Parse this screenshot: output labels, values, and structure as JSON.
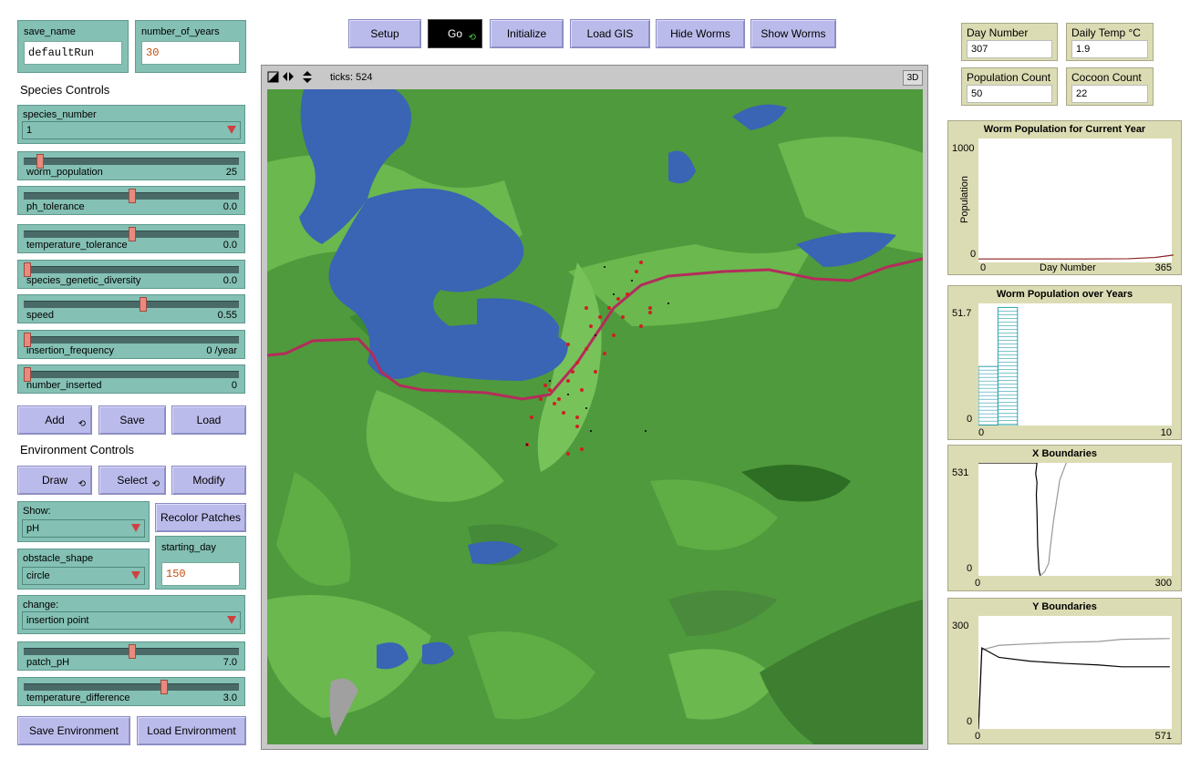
{
  "inputs": {
    "save_name": {
      "label": "save_name",
      "value": "defaultRun"
    },
    "number_of_years": {
      "label": "number_of_years",
      "value": "30"
    },
    "starting_day": {
      "label": "starting_day",
      "value": "150"
    }
  },
  "section_titles": {
    "species": "Species Controls",
    "environment": "Environment Controls"
  },
  "choosers": {
    "species_number": {
      "label": "species_number",
      "value": "1"
    },
    "show": {
      "label": "Show:",
      "value": "pH"
    },
    "obstacle_shape": {
      "label": "obstacle_shape",
      "value": "circle"
    },
    "change": {
      "label": "change:",
      "value": "insertion point"
    }
  },
  "sliders": {
    "worm_population": {
      "name": "worm_population",
      "value": "25",
      "fraction": 0.06
    },
    "ph_tolerance": {
      "name": "ph_tolerance",
      "value": "0.0",
      "fraction": 0.5
    },
    "temperature_tolerance": {
      "name": "temperature_tolerance",
      "value": "0.0",
      "fraction": 0.5
    },
    "species_genetic_diversity": {
      "name": "species_genetic_diversity",
      "value": "0.0",
      "fraction": 0.0
    },
    "speed": {
      "name": "speed",
      "value": "0.55",
      "fraction": 0.55
    },
    "insertion_frequency": {
      "name": "insertion_frequency",
      "value": "0 /year",
      "fraction": 0.0
    },
    "number_inserted": {
      "name": "number_inserted",
      "value": "0",
      "fraction": 0.0
    },
    "patch_pH": {
      "name": "patch_pH",
      "value": "7.0",
      "fraction": 0.5
    },
    "temperature_difference": {
      "name": "temperature_difference",
      "value": "3.0",
      "fraction": 0.65
    }
  },
  "buttons": {
    "add": "Add",
    "save": "Save",
    "load": "Load",
    "draw": "Draw",
    "select": "Select",
    "modify": "Modify",
    "recolor": "Recolor Patches",
    "save_env": "Save Environment",
    "load_env": "Load Environment",
    "setup": "Setup",
    "go": "Go",
    "initialize": "Initialize",
    "load_gis": "Load GIS",
    "hide_worms": "Hide Worms",
    "show_worms": "Show Worms",
    "forever_glyph": "⟲"
  },
  "view": {
    "ticks_label": "ticks: 524",
    "three_d": "3D"
  },
  "monitors": {
    "day_number": {
      "label": "Day Number",
      "value": "307"
    },
    "daily_temp": {
      "label": "Daily Temp °C",
      "value": "1.9"
    },
    "population_count": {
      "label": "Population Count",
      "value": "50"
    },
    "cocoon_count": {
      "label": "Cocoon Count",
      "value": "22"
    }
  },
  "colors": {
    "teal": "#84c0b4",
    "button": "#bbbbeb",
    "monitor": "#dcdcb4",
    "slider_knob": "#e88a7e",
    "water": "#3a64b4",
    "road": "#b42c5c"
  },
  "chart_data": [
    {
      "type": "line",
      "title": "Worm Population for Current Year",
      "xlabel": "Day Number",
      "ylabel": "Population",
      "xlim": [
        0,
        365
      ],
      "ylim": [
        0,
        1000
      ],
      "series": [
        {
          "color": "#8b2020",
          "x": [
            0,
            100,
            200,
            280,
            330,
            365
          ],
          "y": [
            28,
            28,
            28,
            30,
            40,
            60
          ]
        }
      ]
    },
    {
      "type": "bar",
      "title": "Worm Population over Years",
      "xlim": [
        0,
        10
      ],
      "ylim": [
        0,
        51.7
      ],
      "series": [
        {
          "color": "#30a0b0",
          "x": [
            0,
            1
          ],
          "y": [
            25,
            50
          ]
        }
      ]
    },
    {
      "type": "line",
      "title": "X Boundaries",
      "xlim": [
        0,
        300
      ],
      "ylim": [
        0,
        531
      ],
      "series": [
        {
          "color": "#000000",
          "x": [
            0,
            90,
            88,
            90,
            89,
            90,
            91,
            93,
            95
          ],
          "y": [
            531,
            531,
            480,
            440,
            380,
            300,
            150,
            30,
            0
          ]
        },
        {
          "color": "#999999",
          "x": [
            95,
            102,
            108,
            110,
            115,
            120,
            125,
            135
          ],
          "y": [
            0,
            20,
            60,
            120,
            250,
            350,
            450,
            531
          ]
        }
      ]
    },
    {
      "type": "line",
      "title": "Y Boundaries",
      "xlim": [
        0,
        571
      ],
      "ylim": [
        0,
        300
      ],
      "series": [
        {
          "color": "#999999",
          "x": [
            0,
            10,
            60,
            150,
            250,
            350,
            420,
            560
          ],
          "y": [
            0,
            210,
            222,
            226,
            230,
            232,
            238,
            240
          ]
        },
        {
          "color": "#000000",
          "x": [
            0,
            10,
            60,
            150,
            250,
            350,
            420,
            560
          ],
          "y": [
            0,
            215,
            190,
            180,
            174,
            170,
            165,
            165
          ]
        }
      ]
    }
  ]
}
